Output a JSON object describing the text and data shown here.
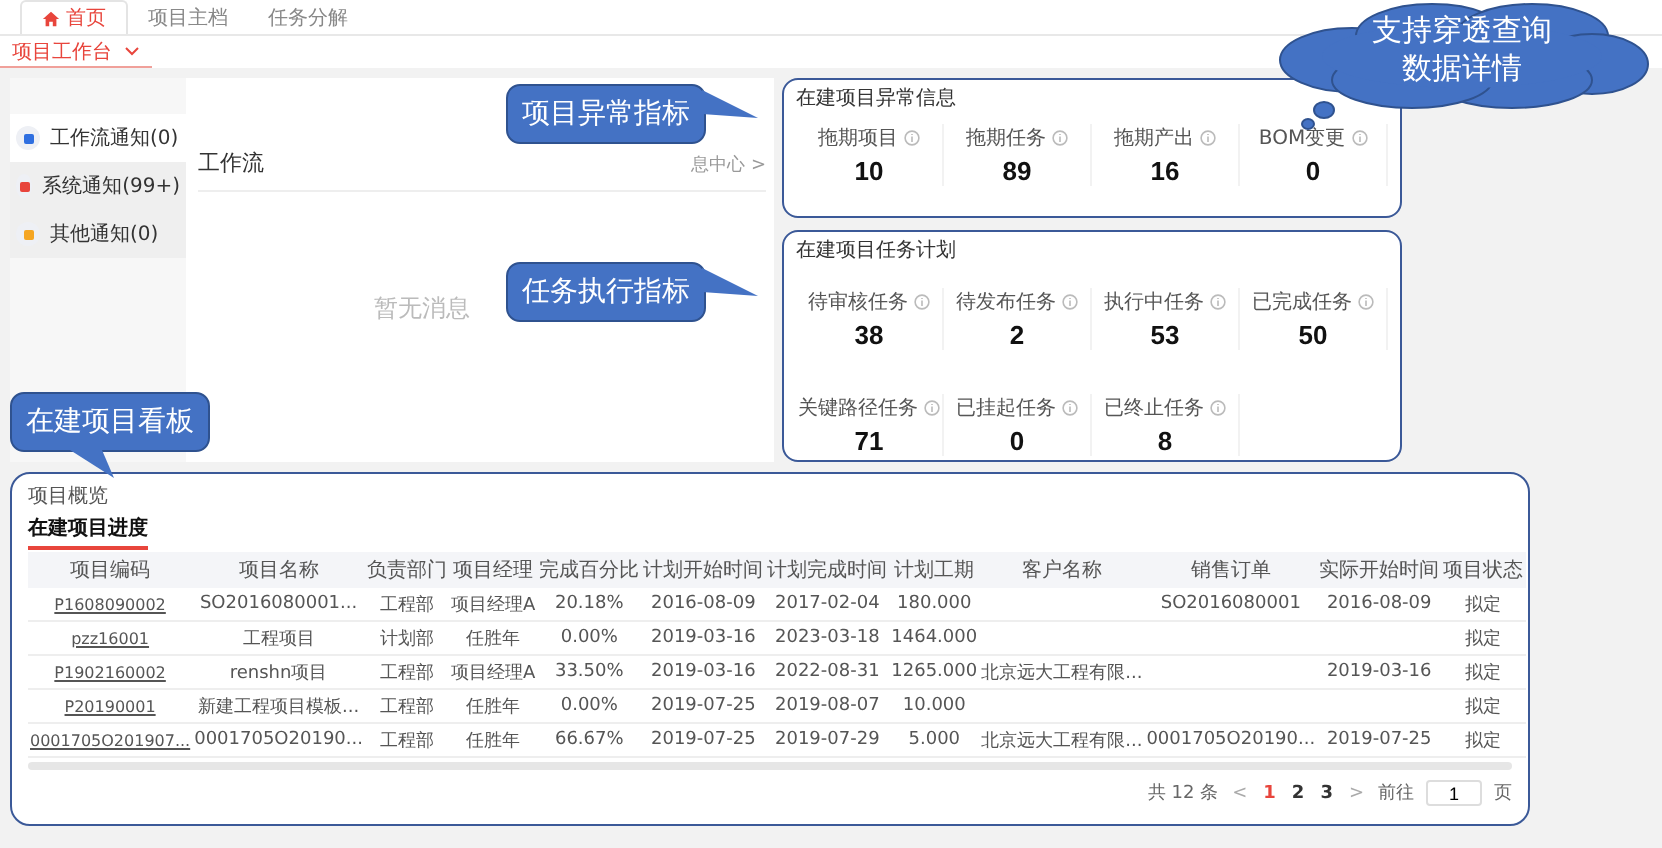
{
  "top_tabs": [
    {
      "label": "首页",
      "kind": "home",
      "selected": true
    },
    {
      "label": "项目主档",
      "kind": "page",
      "selected": false
    },
    {
      "label": "任务分解",
      "kind": "page",
      "selected": false
    }
  ],
  "page_tab": {
    "label": "项目工作台",
    "selected": true
  },
  "notifications": [
    {
      "label": "工作流通知(0)",
      "color": "#2f6fe0",
      "selected": true
    },
    {
      "label": "系统通知(99+)",
      "color": "#e8453c",
      "selected": false
    },
    {
      "label": "其他通知(0)",
      "color": "#f5a623",
      "selected": false
    }
  ],
  "workflow": {
    "title": "工作流",
    "link": "息中心 >",
    "empty_text": "暂无消息"
  },
  "anomaly": {
    "title": "在建项目异常信息",
    "metrics": [
      {
        "label": "拖期项目",
        "value": "10"
      },
      {
        "label": "拖期任务",
        "value": "89"
      },
      {
        "label": "拖期产出",
        "value": "16"
      },
      {
        "label": "BOM变更",
        "value": "0"
      }
    ]
  },
  "tasks": {
    "title": "在建项目任务计划",
    "metrics": [
      {
        "label": "待审核任务",
        "value": "38"
      },
      {
        "label": "待发布任务",
        "value": "2"
      },
      {
        "label": "执行中任务",
        "value": "53"
      },
      {
        "label": "已完成任务",
        "value": "50"
      },
      {
        "label": "关键路径任务",
        "value": "71"
      },
      {
        "label": "已挂起任务",
        "value": "0"
      },
      {
        "label": "已终止任务",
        "value": "8"
      }
    ]
  },
  "overview": {
    "title": "项目概览",
    "tabs": [
      {
        "label": "在建项目进度",
        "selected": true
      }
    ],
    "columns": [
      {
        "label": "项目编码",
        "kind": "link"
      },
      {
        "label": "项目名称",
        "kind": "text"
      },
      {
        "label": "负责部门",
        "kind": "text"
      },
      {
        "label": "项目经理",
        "kind": "text"
      },
      {
        "label": "完成百分比",
        "kind": "text"
      },
      {
        "label": "计划开始时间",
        "kind": "text"
      },
      {
        "label": "计划完成时间",
        "kind": "text"
      },
      {
        "label": "计划工期",
        "kind": "text"
      },
      {
        "label": "客户名称",
        "kind": "text"
      },
      {
        "label": "销售订单",
        "kind": "text"
      },
      {
        "label": "实际开始时间",
        "kind": "text"
      },
      {
        "label": "项目状态",
        "kind": "text"
      }
    ],
    "rows": [
      {
        "code": "P1608090002",
        "name": "SO2016080001...",
        "dept": "工程部",
        "manager": "项目经理A",
        "progress": "20.18%",
        "plan_start": "2016-08-09",
        "plan_end": "2017-02-04",
        "duration": "180.000",
        "sales_order": "SO2016080001",
        "actual_start": "2016-08-09",
        "status": "拟定"
      },
      {
        "code": "pzz16001",
        "name": "工程项目",
        "dept": "计划部",
        "manager": "任胜年",
        "progress": "0.00%",
        "plan_start": "2019-03-16",
        "plan_end": "2023-03-18",
        "duration": "1464.000",
        "status": "拟定"
      },
      {
        "code": "P1902160002",
        "name": "renshn项目",
        "dept": "工程部",
        "manager": "项目经理A",
        "progress": "33.50%",
        "plan_start": "2019-03-16",
        "plan_end": "2022-08-31",
        "duration": "1265.000",
        "customer": "北京远大工程有限...",
        "actual_start": "2019-03-16",
        "status": "拟定"
      },
      {
        "code": "P20190001",
        "name": "新建工程项目模板...",
        "dept": "工程部",
        "manager": "任胜年",
        "progress": "0.00%",
        "plan_start": "2019-07-25",
        "plan_end": "2019-08-07",
        "duration": "10.000",
        "status": "拟定"
      },
      {
        "code": "0001705O201907...",
        "name": "0001705O20190...",
        "dept": "工程部",
        "manager": "任胜年",
        "progress": "66.67%",
        "plan_start": "2019-07-25",
        "plan_end": "2019-07-29",
        "duration": "5.000",
        "customer": "北京远大工程有限...",
        "sales_order": "0001705O20190...",
        "actual_start": "2019-07-25",
        "status": "拟定"
      }
    ],
    "pagination": {
      "total": "共 12 条",
      "prev": "<",
      "pages": [
        {
          "label": "1",
          "selected": true
        },
        {
          "label": "2",
          "selected": false
        },
        {
          "label": "3",
          "selected": false
        }
      ],
      "next": ">",
      "goto": "前往",
      "page_input": "1",
      "unit": "页"
    }
  },
  "callouts": [
    {
      "kind": "box",
      "text": "项目异常指标"
    },
    {
      "kind": "box",
      "text": "任务执行指标"
    },
    {
      "kind": "down",
      "text": "在建项目看板"
    },
    {
      "kind": "cloud",
      "lines": [
        "支持穿透查询",
        "数据详情"
      ]
    }
  ]
}
